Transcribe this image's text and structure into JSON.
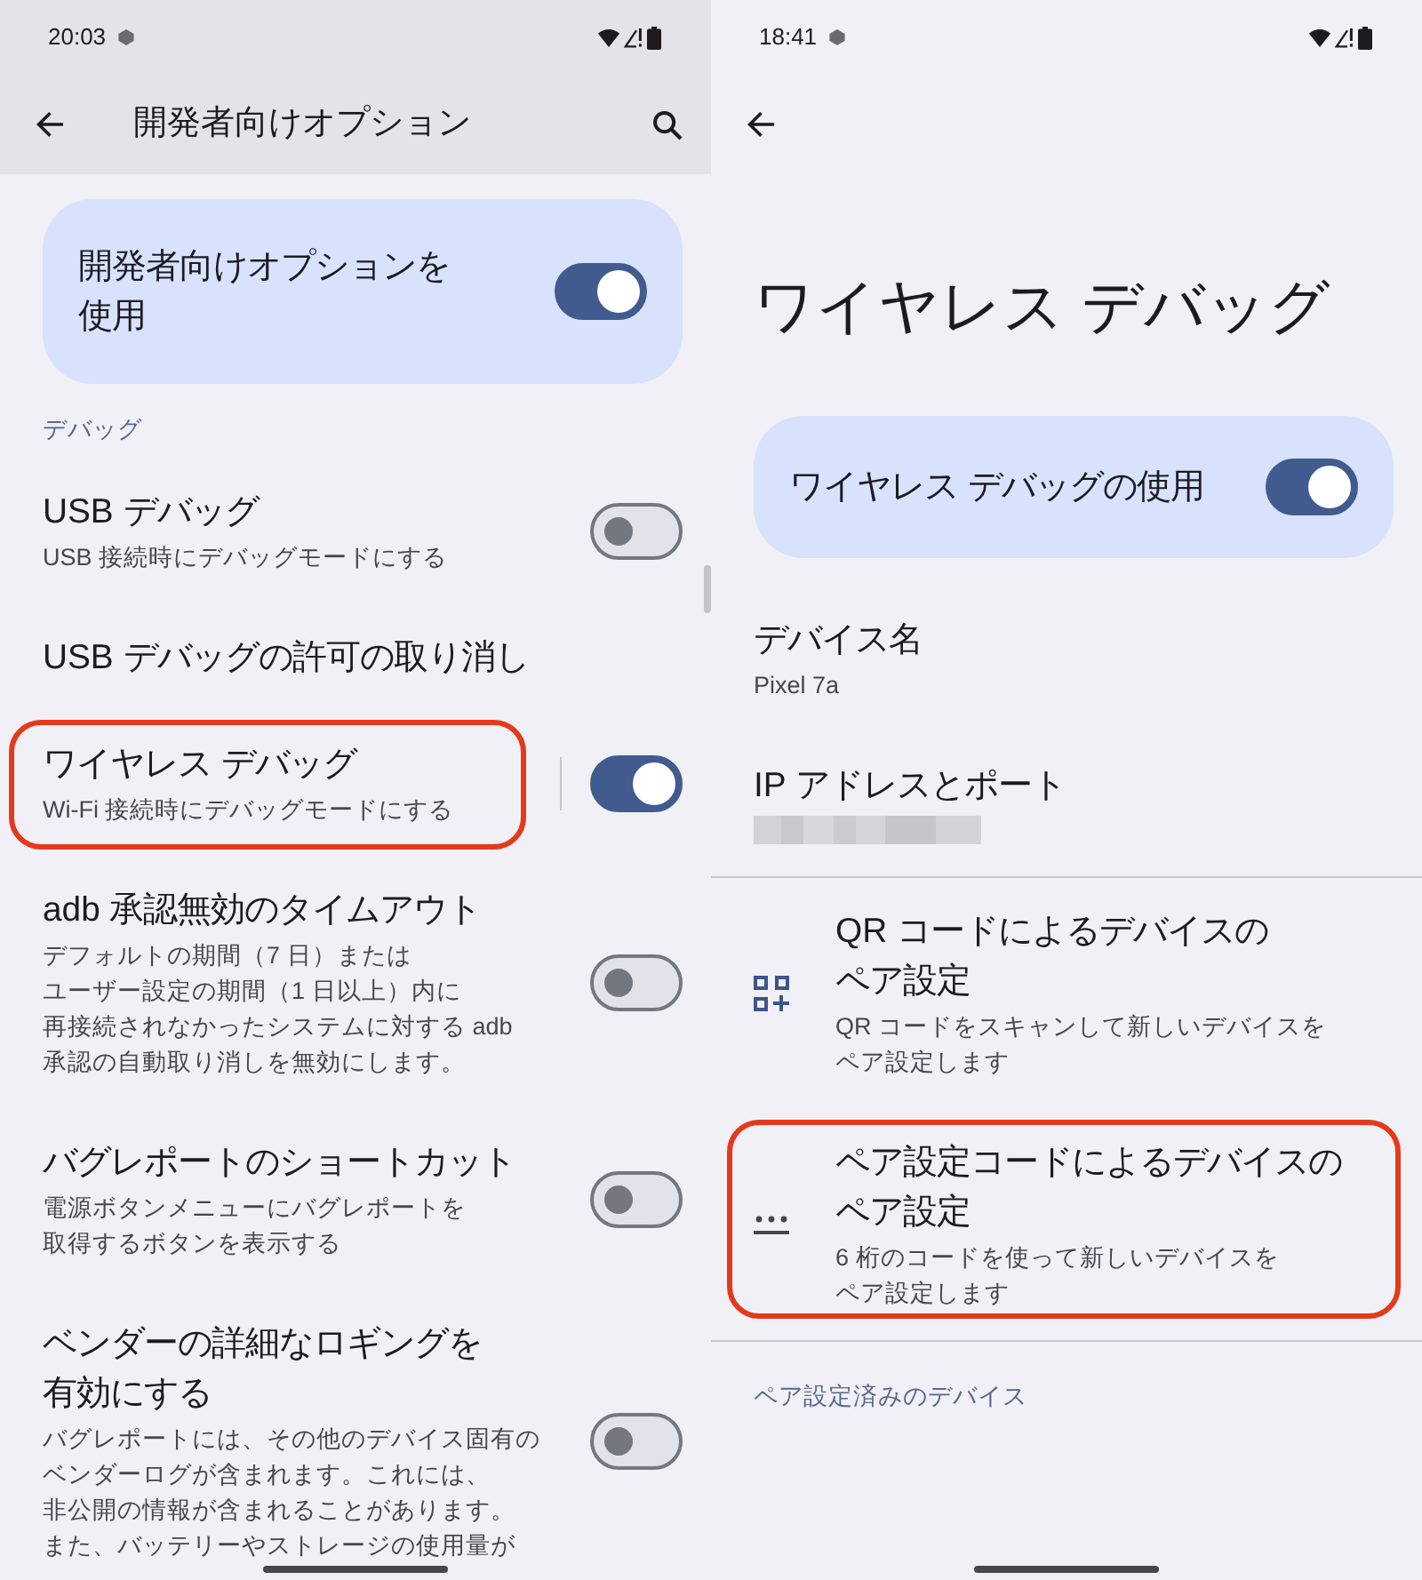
{
  "screens": [
    {
      "scrolled": true,
      "status_bar": {
        "time": "20:03"
      },
      "app_bar": {
        "title": "開発者向けオプション",
        "search": true
      },
      "main_switch": {
        "label": "開発者向けオプションを使用",
        "on": true
      },
      "items": [
        {
          "kind": "header",
          "title": "デバッグ",
          "highlighted": false
        },
        {
          "kind": "switch",
          "title": "USB デバッグ",
          "summary": "USB 接続時にデバッグモードにする",
          "on": false,
          "highlighted": false
        },
        {
          "kind": "plain",
          "title": "USB デバッグの許可の取り消し",
          "highlighted": false
        },
        {
          "kind": "split_switch",
          "title": "ワイヤレス デバッグ",
          "summary": "Wi-Fi 接続時にデバッグモードにする",
          "on": true,
          "highlighted": true
        },
        {
          "kind": "switch",
          "title": "adb 承認無効のタイムアウト",
          "summary": "デフォルトの期間（7 日）またはユーザー設定の期間（1 日以上）内に再接続されなかったシステムに対する adb 承認の自動取り消しを無効にします。",
          "on": false,
          "highlighted": false
        },
        {
          "kind": "switch",
          "title": "バグレポートのショートカット",
          "summary": "電源ボタンメニューにバグレポートを取得するボタンを表示する",
          "on": false,
          "highlighted": false
        },
        {
          "kind": "switch",
          "title": "ベンダーの詳細なロギングを有効にする",
          "summary": "バグレポートには、その他のデバイス固有のベンダーログが含まれます。これには、非公開の情報が含まれることがあります。また、バッテリーやストレージの使用量が",
          "on": false,
          "highlighted": false
        }
      ]
    },
    {
      "scrolled": false,
      "status_bar": {
        "time": "18:41"
      },
      "app_bar": {
        "search": false
      },
      "large_title": "ワイヤレス デバッグ",
      "main_switch": {
        "label": "ワイヤレス デバッグの使用",
        "on": true
      },
      "items": [
        {
          "kind": "info",
          "title": "デバイス名",
          "summary": "Pixel 7a",
          "divider_above": false,
          "highlighted": false
        },
        {
          "kind": "redacted",
          "title": "IP アドレスとポート",
          "divider_above": false,
          "highlighted": false
        },
        {
          "kind": "qr_action",
          "title": "QR コードによるデバイスのペア設定",
          "summary": "QR コードをスキャンして新しいデバイスをペア設定します",
          "divider_above": true,
          "highlighted": false
        },
        {
          "kind": "code_action",
          "title": "ペア設定コードによるデバイスのペア設定",
          "summary": "6 桁のコードを使って新しいデバイスをペア設定します",
          "divider_above": false,
          "highlighted": true
        },
        {
          "kind": "header",
          "title": "ペア設定済みのデバイス",
          "divider_above": true,
          "highlighted": false
        }
      ]
    }
  ]
}
